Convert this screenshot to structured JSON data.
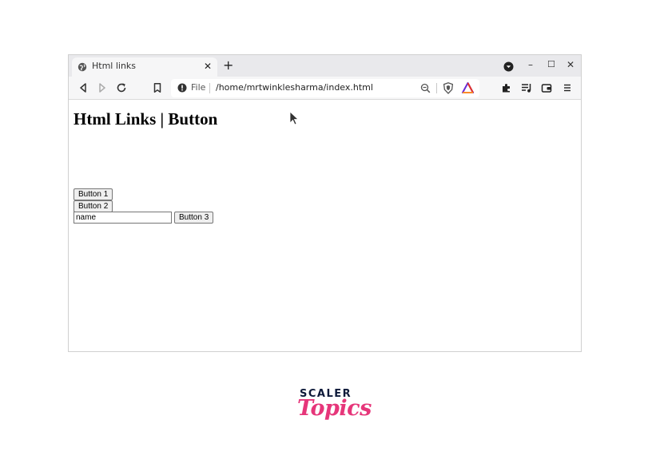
{
  "browser": {
    "tab": {
      "title": "Html links",
      "close_glyph": "✕",
      "favicon": "globe-icon"
    },
    "new_tab_glyph": "+",
    "window_controls": {
      "minimize": "–",
      "maximize": "☐",
      "close": "✕"
    },
    "toolbar": {
      "icons": [
        "back-icon",
        "forward-icon",
        "reload-icon",
        "bookmark-icon",
        "info-icon",
        "zoom-icon",
        "brave-shield-icon",
        "brave-rewards-icon",
        "extensions-icon",
        "playlist-icon",
        "wallet-icon",
        "menu-icon"
      ],
      "url_scheme": "File",
      "url": "/home/mrtwinklesharma/index.html"
    },
    "colors": {
      "tabbar": "#e9e9ec",
      "toolbar": "#f6f6f7",
      "brave_orange": "#fb542b",
      "rewards_red": "#e0312a",
      "rewards_purple": "#6a2bd6"
    }
  },
  "page": {
    "heading": "Html Links | Button",
    "button1": "Button 1",
    "button2": "Button 2",
    "input_value": "name",
    "button3": "Button 3"
  },
  "branding": {
    "scaler": "SCALER",
    "topics": "Topics",
    "colors": {
      "scaler": "#0e1a3a",
      "topics": "#e6367a"
    }
  }
}
